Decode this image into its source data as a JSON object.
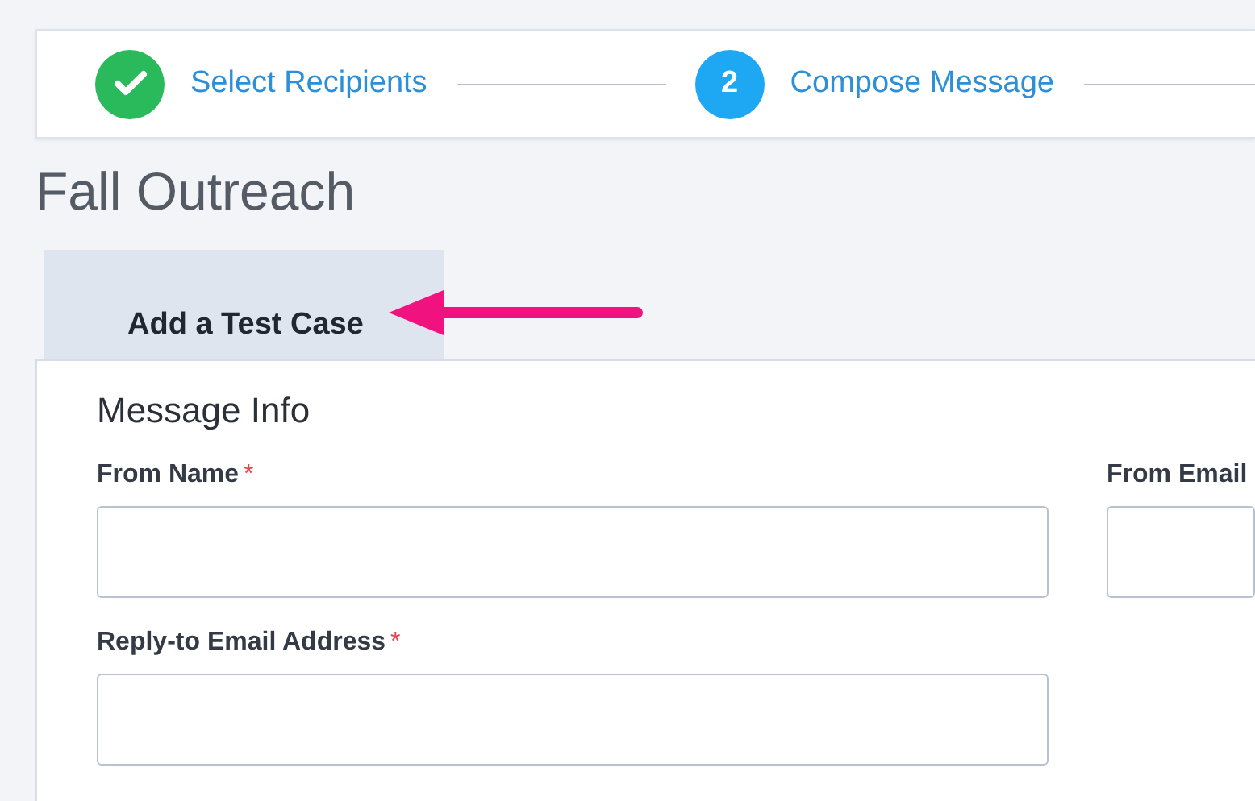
{
  "steps": [
    {
      "label": "Select Recipients",
      "completed": true
    },
    {
      "label": "Compose Message",
      "completed": false,
      "number": "2"
    }
  ],
  "title": "Fall Outreach",
  "tab": {
    "label": "Add a Test Case",
    "selected": true
  },
  "section": {
    "heading": "Message Info",
    "fields": [
      {
        "label": "From Name",
        "required_mark": "*"
      },
      {
        "label": "From Email"
      },
      {
        "label": "Reply-to Email Address",
        "required_mark": "*"
      }
    ]
  }
}
